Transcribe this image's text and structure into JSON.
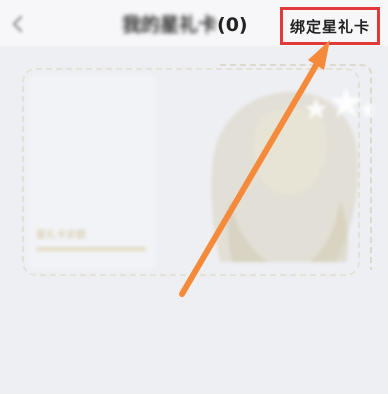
{
  "header": {
    "back_icon": "chevron-left-icon",
    "title_name": "我的星礼卡",
    "title_count": "(0)",
    "bind_button_label": "绑定星礼卡"
  },
  "card": {
    "label_text": "星礼卡余额",
    "siren_icon": "siren-logo-icon"
  },
  "annotation": {
    "highlight_color": "#e23a3a",
    "arrow_color": "#f58a3a"
  }
}
